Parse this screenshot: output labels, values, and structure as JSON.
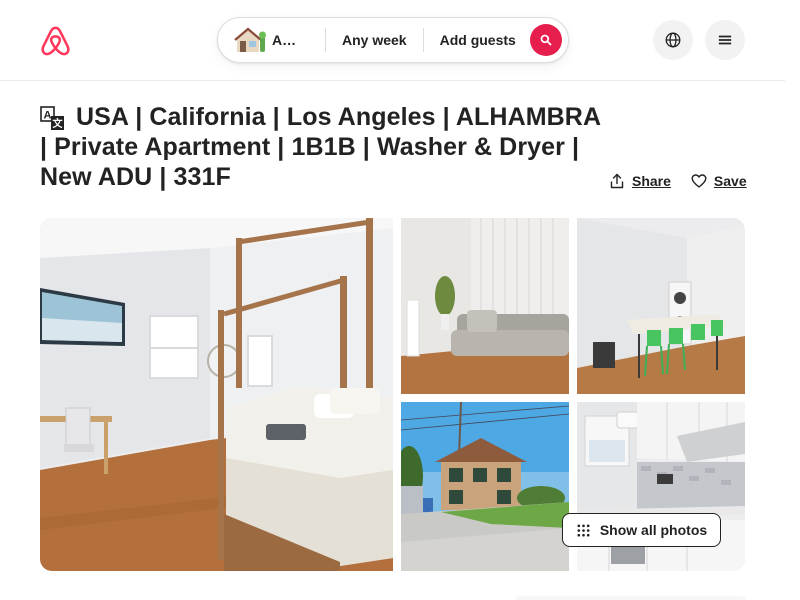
{
  "header": {
    "logo_icon": "airbnb-logo-icon",
    "brand_color": "#ff385c",
    "search": {
      "location_label": "Anywhere",
      "location_icon": "house-icon",
      "date_label": "Any week",
      "guests_label": "Add guests",
      "search_icon": "search-icon",
      "search_button_color": "#e61e4d"
    },
    "globe_icon": "globe-icon",
    "menu_icon": "hamburger-menu-icon"
  },
  "listing": {
    "translate_icon": "translate-icon",
    "title": "USA | California | Los Angeles | ALHAMBRA | Private Apartment | 1B1B | Washer & Dryer | New ADU | 331F",
    "actions": {
      "share_label": "Share",
      "share_icon": "share-icon",
      "save_label": "Save",
      "save_icon": "heart-icon"
    }
  },
  "gallery": {
    "photos": [
      {
        "subject": "bedroom"
      },
      {
        "subject": "living room"
      },
      {
        "subject": "dining area"
      },
      {
        "subject": "exterior"
      },
      {
        "subject": "kitchen"
      }
    ],
    "show_all_label": "Show all photos",
    "show_all_icon": "grid-dots-icon"
  }
}
